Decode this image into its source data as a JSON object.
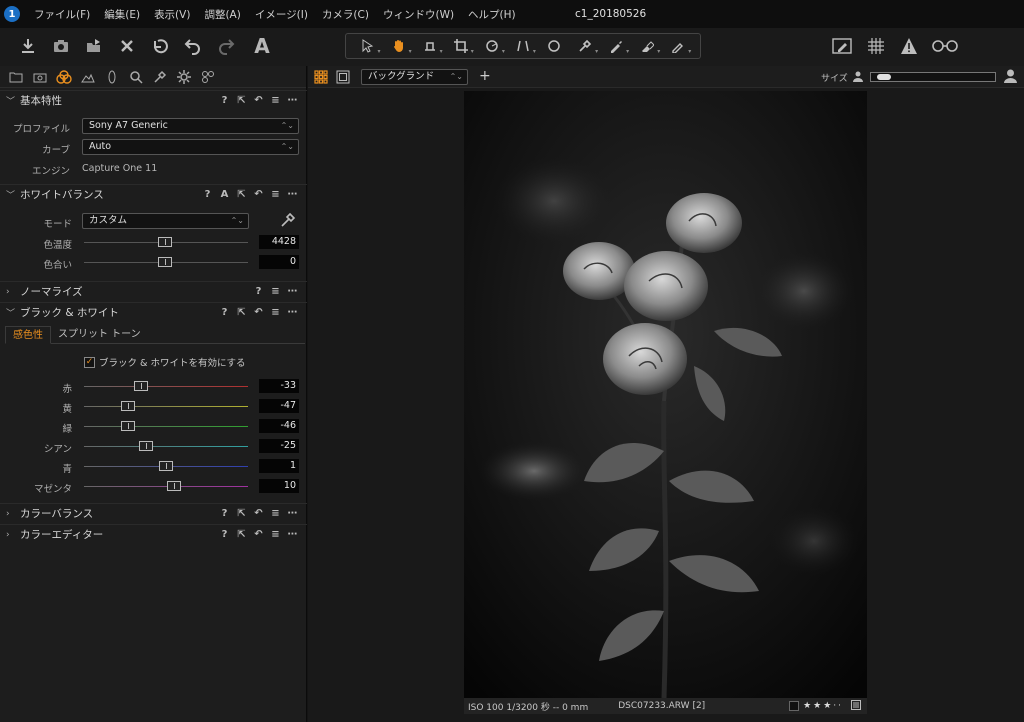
{
  "app": {
    "logo_text": "1",
    "window_title": "c1_20180526"
  },
  "menu": [
    "ファイル(F)",
    "編集(E)",
    "表示(V)",
    "調整(A)",
    "イメージ(I)",
    "カメラ(C)",
    "ウィンドウ(W)",
    "ヘルプ(H)"
  ],
  "toolbar": {
    "text_tool_label": "A"
  },
  "left_panel": {
    "basic": {
      "title": "基本特性",
      "profile_label": "プロファイル",
      "profile_value": "Sony A7 Generic",
      "curve_label": "カーブ",
      "curve_value": "Auto",
      "engine_label": "エンジン",
      "engine_value": "Capture One 11"
    },
    "wb": {
      "title": "ホワイトバランス",
      "mode_label": "モード",
      "mode_value": "カスタム",
      "temp_label": "色温度",
      "temp_value": "4428",
      "tint_label": "色合い",
      "tint_value": "0"
    },
    "noise": {
      "title": "ノーマライズ"
    },
    "bw": {
      "title": "ブラック & ホワイト",
      "tab_sensitivity": "感色性",
      "tab_split": "スプリット トーン",
      "enable_label": "ブラック & ホワイトを有効にする",
      "sliders": [
        {
          "label": "赤",
          "value": "-33",
          "color": "#b03030",
          "pos": 0.35
        },
        {
          "label": "黄",
          "value": "-47",
          "color": "#b0b030",
          "pos": 0.27
        },
        {
          "label": "緑",
          "value": "-46",
          "color": "#30a030",
          "pos": 0.27
        },
        {
          "label": "シアン",
          "value": "-25",
          "color": "#30a0a0",
          "pos": 0.38
        },
        {
          "label": "青",
          "value": "1",
          "color": "#3040b0",
          "pos": 0.5
        },
        {
          "label": "マゼンタ",
          "value": "10",
          "color": "#a030a0",
          "pos": 0.55
        }
      ]
    },
    "color_balance": {
      "title": "カラーバランス"
    },
    "color_editor": {
      "title": "カラーエディター"
    }
  },
  "viewer": {
    "bg_select": "バックグランド",
    "size_label": "サイズ",
    "info_exif": "ISO 100  1/3200 秒  --  0 mm",
    "info_file": "DSC07233.ARW [2]",
    "accent": "#e98f1f"
  }
}
